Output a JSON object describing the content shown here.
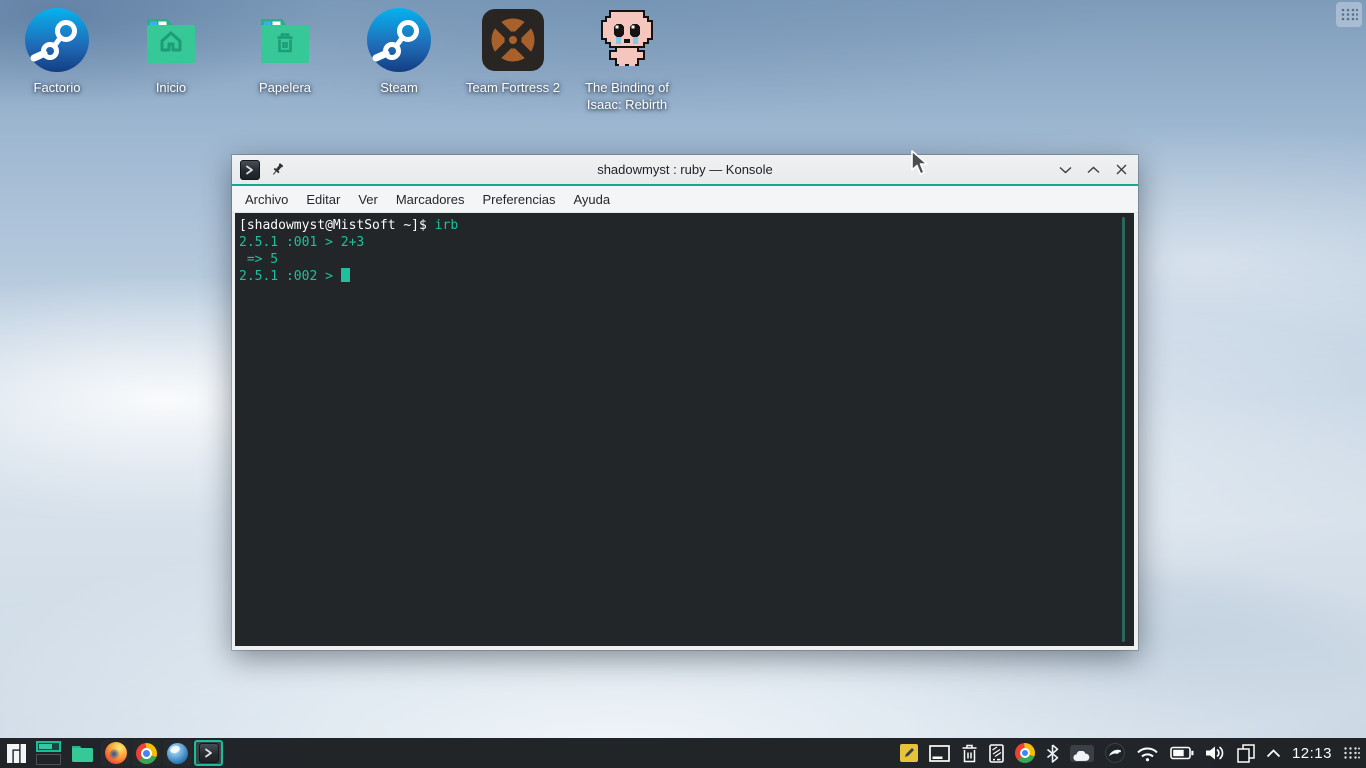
{
  "desktop": {
    "icons": [
      {
        "label": "Factorio",
        "icon": "steam-icon"
      },
      {
        "label": "Inicio",
        "icon": "folder-home-icon"
      },
      {
        "label": "Papelera",
        "icon": "folder-trash-icon"
      },
      {
        "label": "Steam",
        "icon": "steam-icon"
      },
      {
        "label": "Team Fortress 2",
        "icon": "tf2-icon"
      },
      {
        "label": "The Binding of Isaac: Rebirth",
        "icon": "isaac-icon"
      }
    ]
  },
  "window": {
    "title": "shadowmyst : ruby — Konsole",
    "titlebar_icons": [
      "konsole-icon",
      "pin-icon"
    ],
    "controls": [
      "minimize",
      "maximize",
      "close"
    ],
    "menu": [
      "Archivo",
      "Editar",
      "Ver",
      "Marcadores",
      "Preferencias",
      "Ayuda"
    ],
    "terminal": {
      "line1_prompt": "[shadowmyst@MistSoft ~]$ ",
      "line1_command": "irb",
      "line2": "2.5.1 :001 > 2+3",
      "line3": " => 5",
      "line4_prompt": "2.5.1 :002 > "
    }
  },
  "taskbar": {
    "launchers": [
      "manjaro-menu",
      "virtual-desktop-pager",
      "dolphin-folder",
      "firefox",
      "chrome",
      "web-browser"
    ],
    "active_task": "konsole",
    "tray_icons": [
      "sticky-note",
      "frame",
      "trash",
      "kdeconnect-phone",
      "chrome",
      "bluetooth",
      "cloud",
      "globe-bird",
      "wifi",
      "battery",
      "volume",
      "clipboard",
      "expand-chevron"
    ],
    "clock": "12:13"
  },
  "colors": {
    "accent_teal": "#1abc9c",
    "titlebar_divider": "#12ab8d",
    "terminal_bg": "#232629",
    "terminal_teal": "#20bf9d",
    "terminal_white": "#fcfcfc",
    "titlebar_bg": "#eef0f1",
    "taskbar_bg": "#191c1f",
    "folder_green": "#36c897",
    "steam_blue": "#1a63ad"
  }
}
